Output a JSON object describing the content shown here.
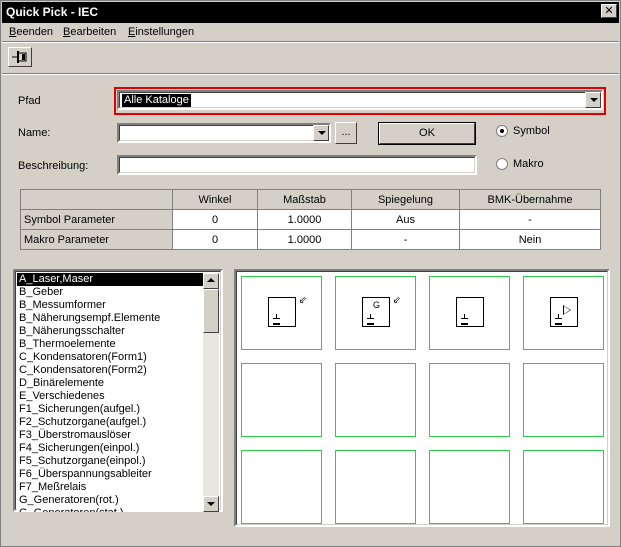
{
  "window": {
    "title": "Quick Pick - IEC",
    "close_glyph": "✕"
  },
  "menu": {
    "items": [
      {
        "accel": "B",
        "rest": "eenden"
      },
      {
        "accel": "B",
        "rest": "earbeiten"
      },
      {
        "accel": "E",
        "rest": "instellungen"
      }
    ]
  },
  "toolbar": {
    "pin_icon": "pin-icon"
  },
  "form": {
    "path_label": "Pfad",
    "path_value": "Alle Kataloge",
    "name_label": "Name:",
    "name_value": "",
    "browse_label": "...",
    "ok_label": "OK",
    "description_label": "Beschreibung:",
    "description_value": "",
    "radio_symbol": "Symbol",
    "radio_macro": "Makro",
    "selected_radio": "Symbol",
    "highlight_color": "#e00000"
  },
  "params_table": {
    "headers": [
      "",
      "Winkel",
      "Maßstab",
      "Spiegelung",
      "BMK-Übernahme"
    ],
    "rows": [
      [
        "Symbol Parameter",
        "0",
        "1.0000",
        "Aus",
        "-"
      ],
      [
        "Makro Parameter",
        "0",
        "1.0000",
        "-",
        "Nein"
      ]
    ]
  },
  "categories": [
    "A_Laser,Maser",
    "B_Geber",
    "B_Messumformer",
    "B_Näherungsempf.Elemente",
    "B_Näherungsschalter",
    "B_Thermoelemente",
    "C_Kondensatoren(Form1)",
    "C_Kondensatoren(Form2)",
    "D_Binärelemente",
    "E_Verschiedenes",
    "F1_Sicherungen(aufgel.)",
    "F2_Schutzorgane(aufgel.)",
    "F3_Überstromauslöser",
    "F4_Sicherungen(einpol.)",
    "F5_Schutzorgane(einpol.)",
    "F6_Überspannungsableiter",
    "F7_Meßrelais",
    "G_Generatoren(rot.)",
    "G_Generatoren(stat.)"
  ],
  "selected_category": "A_Laser,Maser",
  "preview": {
    "cell_border_color": "#2ecc40",
    "symbols": [
      {
        "glyph": "",
        "ray": "⇙"
      },
      {
        "glyph": "G",
        "ray": "⇙"
      },
      {
        "glyph": "",
        "ray": ""
      },
      {
        "glyph": "▷",
        "ray": ""
      }
    ]
  }
}
